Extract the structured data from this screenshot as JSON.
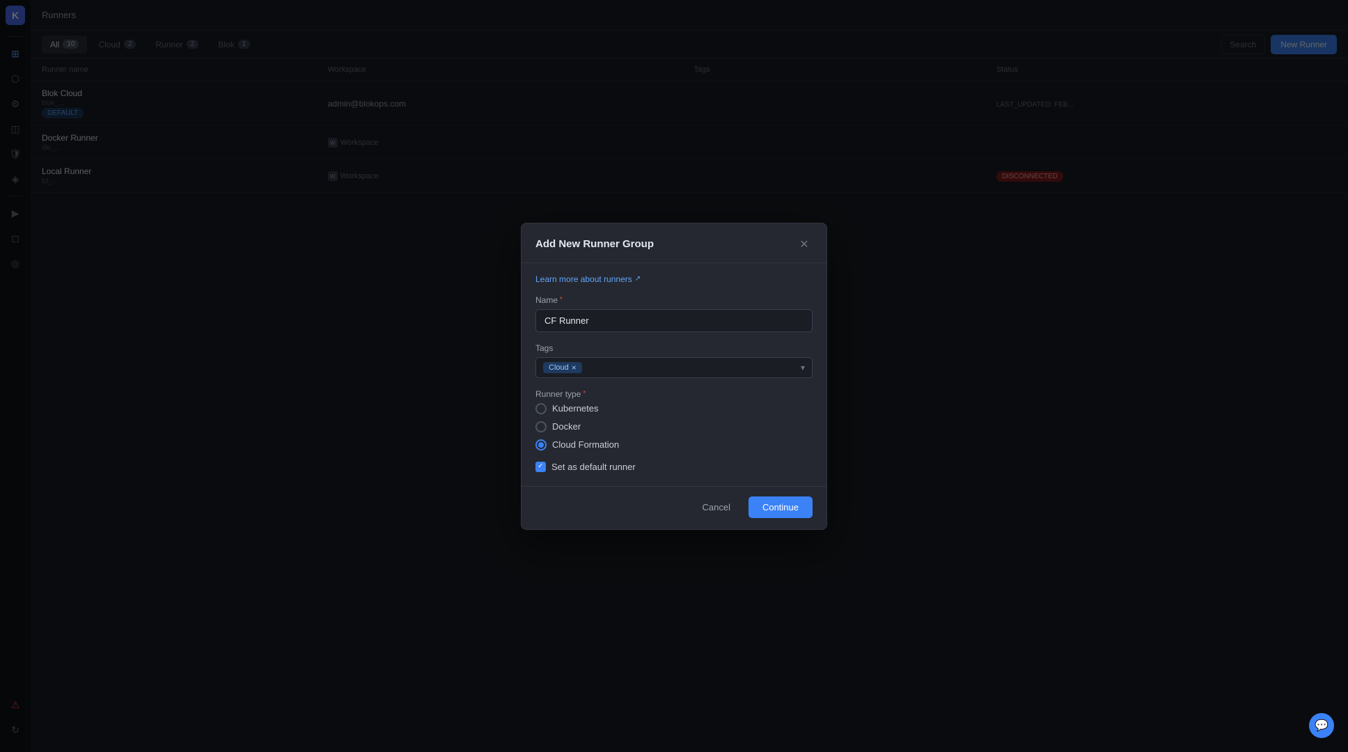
{
  "app": {
    "logo": "K"
  },
  "sidebar": {
    "icons": [
      {
        "name": "grid-icon",
        "symbol": "⊞",
        "active": false
      },
      {
        "name": "puzzle-icon",
        "symbol": "⬡",
        "active": true
      },
      {
        "name": "sliders-icon",
        "symbol": "⊟",
        "active": false
      },
      {
        "name": "database-icon",
        "symbol": "◫",
        "active": false
      },
      {
        "name": "shield-icon",
        "symbol": "⛨",
        "active": false
      },
      {
        "name": "layers-icon",
        "symbol": "◈",
        "active": false
      },
      {
        "name": "terminal-icon",
        "symbol": "▶",
        "active": false
      },
      {
        "name": "chart-icon",
        "symbol": "◻",
        "active": false
      },
      {
        "name": "settings-icon2",
        "symbol": "◎",
        "active": false
      },
      {
        "name": "alert-icon",
        "symbol": "⚠",
        "active": false,
        "danger": true
      },
      {
        "name": "refresh-icon",
        "symbol": "↻",
        "active": false
      }
    ]
  },
  "topbar": {
    "title": "Runners"
  },
  "tabs": [
    {
      "label": "All",
      "count": "10",
      "active": true
    },
    {
      "label": "Cloud",
      "count": "2",
      "active": false
    },
    {
      "label": "Runner",
      "count": "2",
      "active": false
    },
    {
      "label": "Blok",
      "count": "1",
      "active": false
    }
  ],
  "action_bar": {
    "search_button": "Search",
    "new_runner_button": "New Runner"
  },
  "table": {
    "headers": [
      "Runner name",
      "Workspace",
      "Tags",
      "",
      "",
      "Status"
    ],
    "rows": [
      {
        "name": "Blok Cloud",
        "sub": "blok_...",
        "badge": "DEFAULT",
        "workspace": "admin@blokops.com",
        "tags": "",
        "status": "LAST_UPDATED: FEB..."
      },
      {
        "name": "Docker Runner",
        "sub": "dkr_...",
        "badge": "",
        "workspace": "Workspace",
        "tags": "",
        "status": ""
      },
      {
        "name": "Local Runner",
        "sub": "lcl_...",
        "badge": "",
        "workspace": "Workspace",
        "tags": "",
        "status": "DISCONNECTED"
      }
    ]
  },
  "modal": {
    "title": "Add New Runner Group",
    "learn_link": "Learn more about runners",
    "name_label": "Name",
    "name_placeholder": "",
    "name_value": "CF Runner",
    "tags_label": "Tags",
    "tag_chip": "Cloud",
    "runner_type_label": "Runner type",
    "runner_types": [
      {
        "label": "Kubernetes",
        "selected": false
      },
      {
        "label": "Docker",
        "selected": false
      },
      {
        "label": "Cloud Formation",
        "selected": true
      }
    ],
    "default_runner_label": "Set as default runner",
    "default_runner_checked": true,
    "cancel_label": "Cancel",
    "continue_label": "Continue"
  }
}
